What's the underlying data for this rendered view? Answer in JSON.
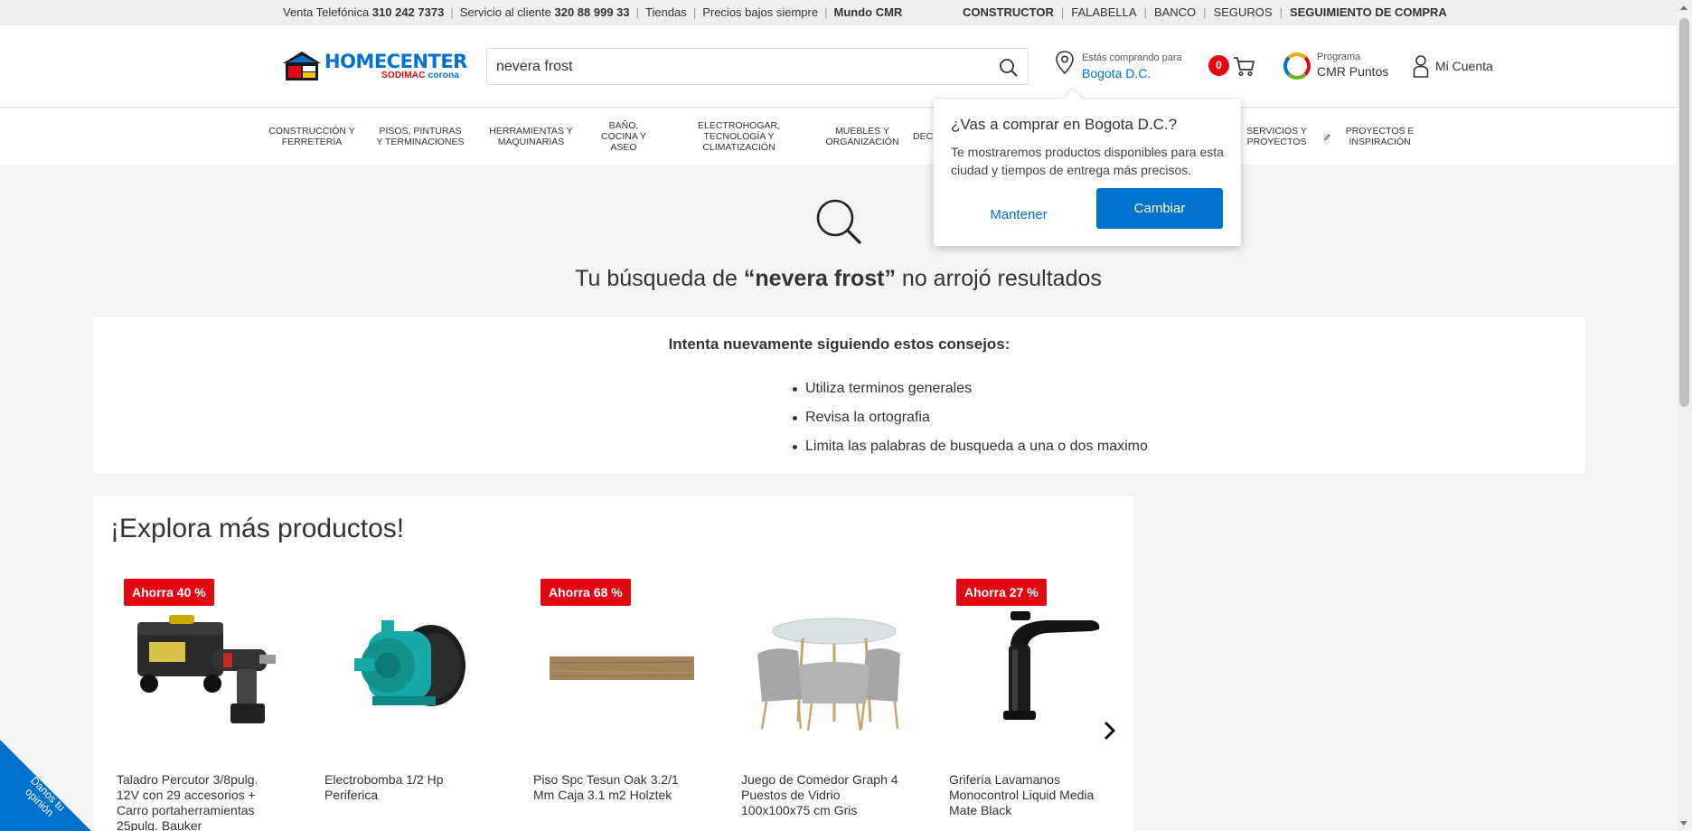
{
  "topbar": {
    "left": [
      {
        "text": "Venta Telefónica ",
        "bold": "310 242 7373"
      },
      {
        "text": "Servicio al cliente ",
        "bold": "320 88 999 33"
      },
      {
        "text": "Tiendas",
        "bold": ""
      },
      {
        "text": "Precios bajos siempre",
        "bold": ""
      },
      {
        "text": "",
        "bold": "Mundo CMR"
      }
    ],
    "right": [
      {
        "text": "",
        "bold": "CONSTRUCTOR"
      },
      {
        "text": "FALABELLA",
        "bold": ""
      },
      {
        "text": "BANCO",
        "bold": ""
      },
      {
        "text": "SEGUROS",
        "bold": ""
      },
      {
        "text": "",
        "bold": "SEGUIMIENTO DE COMPRA"
      }
    ]
  },
  "header": {
    "logo_brand": "HOMECENTER",
    "logo_sub_a": "SODIMAC ",
    "logo_sub_b": "corona",
    "search_value": "nevera frost",
    "location_line1": "Estás comprando para",
    "location_line2": "Bogota D.C.",
    "cart_count": "0",
    "cmr_line1": "Programa",
    "cmr_line2": "CMR Puntos",
    "account_label": "Mi Cuenta"
  },
  "nav": [
    {
      "label": "CONSTRUCCIÓN Y FERRETERÍA"
    },
    {
      "label": "PISOS, PINTURAS Y TERMINACIONES"
    },
    {
      "label": "HERRAMIENTAS Y MAQUINARIAS"
    },
    {
      "label": "BAÑO, COCINA Y ASEO"
    },
    {
      "label": "ELECTROHOGAR, TECNOLOGÍA Y CLIMATIZACIÓN"
    },
    {
      "label": "MUEBLES Y ORGANIZACIÓN"
    },
    {
      "label": "DEC"
    },
    {
      "label": "SERVICIOS Y PROYECTOS"
    },
    {
      "label": "PROYECTOS E INSPIRACIÓN"
    }
  ],
  "popup": {
    "title": "¿Vas a comprar en Bogota D.C.?",
    "text": "Te mostraremos productos disponibles para esta ciudad y tiempos de entrega más precisos.",
    "keep": "Mantener",
    "change": "Cambiar"
  },
  "noresults": {
    "prefix": "Tu búsqueda de ",
    "query": "“nevera frost”",
    "suffix": " no arrojó resultados"
  },
  "tips": {
    "title": "Intenta nuevamente siguiendo estos consejos:",
    "items": [
      "Utiliza terminos generales",
      "Revisa la ortografia",
      "Limita las palabras de busqueda a una o dos maximo"
    ]
  },
  "explore": {
    "title": "¡Explora más productos!",
    "products": [
      {
        "badge": "Ahorra 40 %",
        "name": "Taladro Percutor 3/8pulg. 12V con 29 accesorios + Carro portaherramientas 25pulg. Bauker",
        "icon": "drill-kit-image"
      },
      {
        "badge": "",
        "name": "Electrobomba 1/2 Hp Periferica",
        "icon": "water-pump-image"
      },
      {
        "badge": "Ahorra 68 %",
        "name": "Piso Spc Tesun Oak 3.2/1 Mm Caja 3.1 m2 Holztek",
        "icon": "floor-plank-image"
      },
      {
        "badge": "",
        "name": "Juego de Comedor Graph 4 Puestos de Vidrio 100x100x75 cm Gris",
        "icon": "dining-set-image"
      },
      {
        "badge": "Ahorra 27 %",
        "name": "Grifería Lavamanos Monocontrol Liquid Media Mate Black",
        "icon": "faucet-image"
      }
    ]
  },
  "feedback": {
    "label": "Danos tu opinión"
  },
  "colors": {
    "brand_blue": "#0072ce",
    "brand_red": "#e30613"
  }
}
